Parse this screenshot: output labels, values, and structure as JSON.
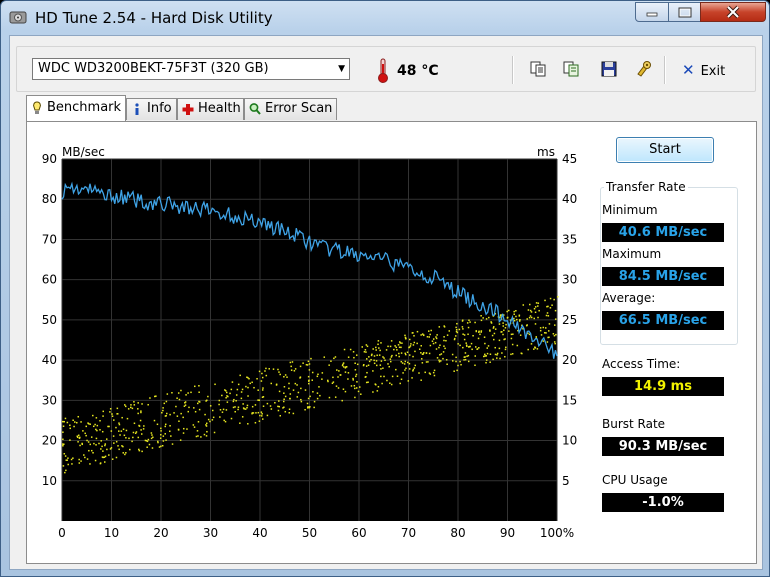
{
  "window": {
    "title": "HD Tune 2.54 - Hard Disk Utility",
    "buttons": {
      "minimize": "minimize",
      "maximize": "maximize",
      "close": "close"
    }
  },
  "toolbar": {
    "drive": "WDC WD3200BEKT-75F3T (320 GB)",
    "temperature": "48 °C",
    "exit_label": "Exit",
    "icons": [
      "copy-icon",
      "copy-info-icon",
      "save-icon",
      "options-icon"
    ]
  },
  "tabs": [
    {
      "label": "Benchmark",
      "icon": "benchmark-icon",
      "active": true
    },
    {
      "label": "Info",
      "icon": "info-icon",
      "active": false
    },
    {
      "label": "Health",
      "icon": "health-icon",
      "active": false
    },
    {
      "label": "Error Scan",
      "icon": "error-scan-icon",
      "active": false
    }
  ],
  "benchmark": {
    "start_label": "Start",
    "transfer_rate": {
      "title": "Transfer Rate",
      "minimum_label": "Minimum",
      "minimum": "40.6 MB/sec",
      "maximum_label": "Maximum",
      "maximum": "84.5 MB/sec",
      "average_label": "Average:",
      "average": "66.5 MB/sec"
    },
    "access_time_label": "Access Time:",
    "access_time": "14.9 ms",
    "burst_rate_label": "Burst Rate",
    "burst_rate": "90.3 MB/sec",
    "cpu_usage_label": "CPU Usage",
    "cpu_usage": "-1.0%"
  },
  "colors": {
    "transfer_line": "#3fa3e6",
    "access_dots": "#e8e820",
    "value_blue": "#29a3e8",
    "value_yellow": "#f4f400"
  },
  "chart_data": {
    "type": "line",
    "ylabel_left": "MB/sec",
    "ylabel_right": "ms",
    "ylim_left": [
      0,
      90
    ],
    "ylim_right": [
      0,
      45
    ],
    "yticks_left": [
      "10",
      "20",
      "30",
      "40",
      "50",
      "60",
      "70",
      "80",
      "90"
    ],
    "yticks_right": [
      "5",
      "10",
      "15",
      "20",
      "25",
      "30",
      "35",
      "40",
      "45"
    ],
    "xticks": [
      "0",
      "10",
      "20",
      "30",
      "40",
      "50",
      "60",
      "70",
      "80",
      "90",
      "100%"
    ],
    "xlim": [
      0,
      100
    ],
    "series": [
      {
        "axis": "left",
        "x": [
          0,
          2,
          4,
          6,
          8,
          10,
          12,
          14,
          16,
          18,
          20,
          22,
          24,
          26,
          28,
          30,
          32,
          34,
          36,
          38,
          40,
          42,
          44,
          46,
          48,
          50,
          52,
          54,
          56,
          58,
          60,
          62,
          64,
          66,
          68,
          70,
          72,
          74,
          76,
          78,
          80,
          82,
          84,
          86,
          88,
          90,
          92,
          94,
          96,
          98,
          100
        ],
        "values": [
          82,
          83,
          82.5,
          82,
          81.5,
          81,
          80.5,
          80,
          79.5,
          79,
          79,
          78.5,
          78,
          78,
          77.5,
          77,
          76.5,
          76,
          75.5,
          75,
          74.5,
          73.5,
          72.5,
          71.5,
          70.5,
          69.5,
          68,
          67.5,
          67,
          66.5,
          66,
          65.5,
          65,
          64.5,
          63.5,
          63,
          62,
          61,
          60,
          58,
          57,
          55.5,
          54,
          53,
          51.5,
          50,
          48.5,
          47,
          45,
          43,
          41
        ]
      }
    ],
    "access_time": {
      "axis": "right",
      "range_start_ms": [
        6,
        13
      ],
      "range_end_ms": [
        22,
        28
      ]
    }
  }
}
